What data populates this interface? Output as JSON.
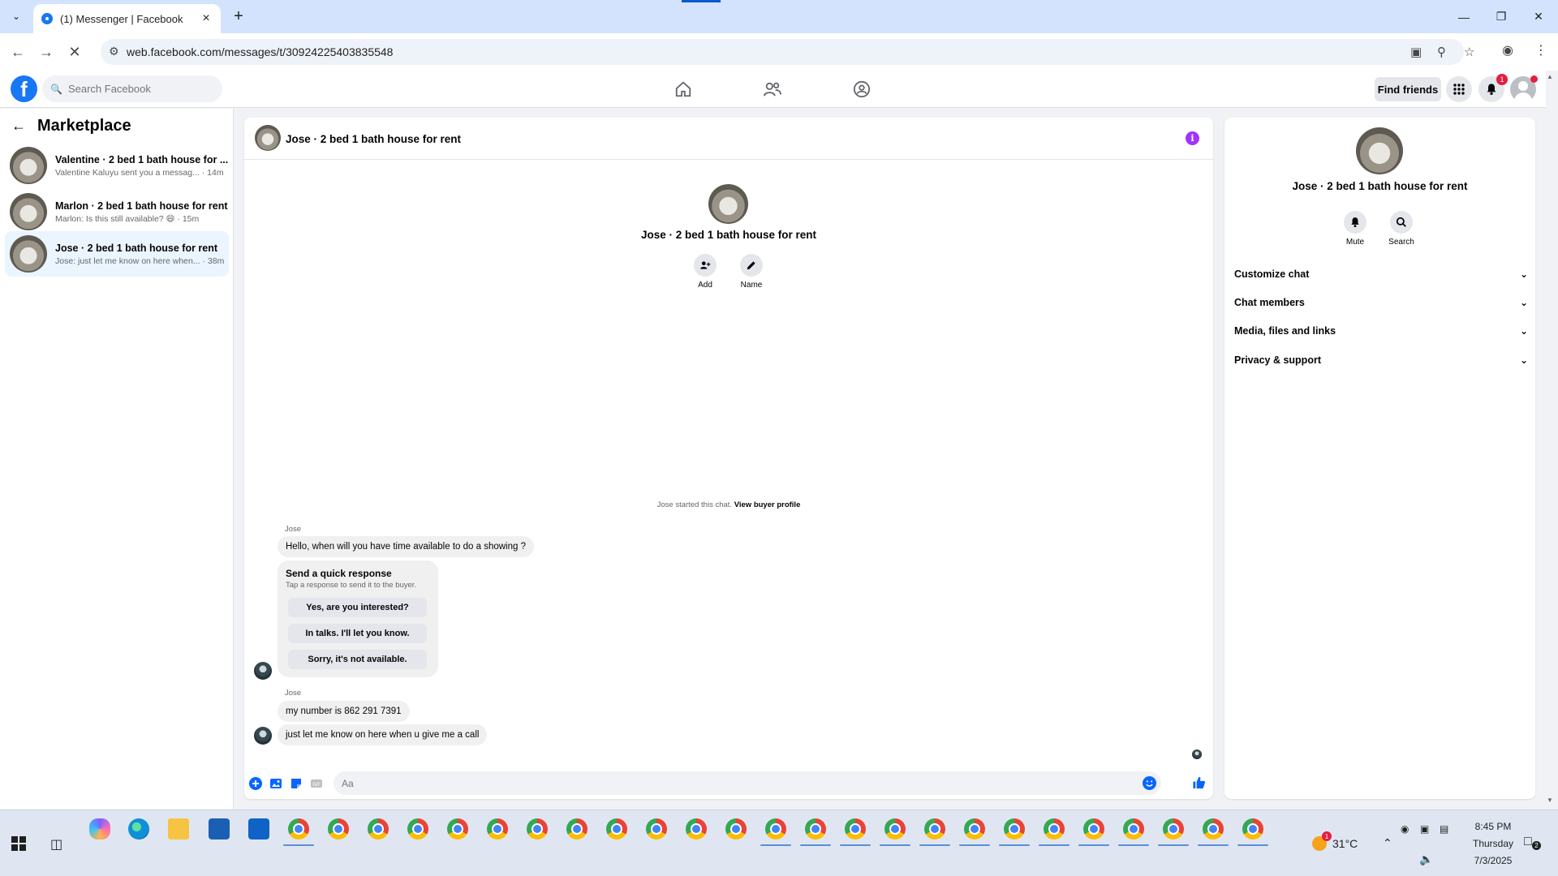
{
  "browser": {
    "tab_title": "(1) Messenger | Facebook",
    "url": "web.facebook.com/messages/t/30924225403835548"
  },
  "fb_header": {
    "search_placeholder": "Search Facebook",
    "find_friends": "Find friends",
    "notification_count": "1"
  },
  "sidebar": {
    "title": "Marketplace",
    "conversations": [
      {
        "name": "Valentine · 2 bed 1 bath house for ...",
        "snippet": "Valentine Kaluyu sent you a messag... · 14m"
      },
      {
        "name": "Marlon · 2 bed 1 bath house for rent",
        "snippet": "Marlon: Is this still available? 😄 · 15m"
      },
      {
        "name": "Jose · 2 bed 1 bath house for rent",
        "snippet": "Jose: just let me know on here when... · 38m"
      }
    ]
  },
  "chat": {
    "header_name": "Jose · 2 bed 1 bath house for rent",
    "hero_name": "Jose · 2 bed 1 bath house for rent",
    "actions": {
      "add": "Add",
      "name": "Name"
    },
    "started_text": "Jose started this chat.",
    "started_link": "View buyer profile",
    "sender": "Jose",
    "messages": {
      "m1": "Hello, when will you have time available to do a showing ?",
      "m2": "my number is 862 291 7391",
      "m3": "just let me know on here when u give me a call"
    },
    "quick": {
      "title": "Send a quick response",
      "subtitle": "Tap a response to send it to the buyer.",
      "options": [
        "Yes, are you interested?",
        "In talks. I'll let you know.",
        "Sorry, it's not available."
      ]
    },
    "composer_placeholder": "Aa"
  },
  "right_panel": {
    "name": "Jose · 2 bed 1 bath house for rent",
    "mute": "Mute",
    "search": "Search",
    "sections": [
      "Customize chat",
      "Chat members",
      "Media, files and links",
      "Privacy & support"
    ]
  },
  "taskbar": {
    "temperature": "31°C",
    "weather_badge": "1",
    "time": "8:45 PM",
    "day": "Thursday",
    "date": "7/3/2025",
    "notifications": "2"
  },
  "colors": {
    "fb_blue": "#1877f2",
    "info_purple": "#a033ff",
    "active_row": "#ebf5ff"
  }
}
